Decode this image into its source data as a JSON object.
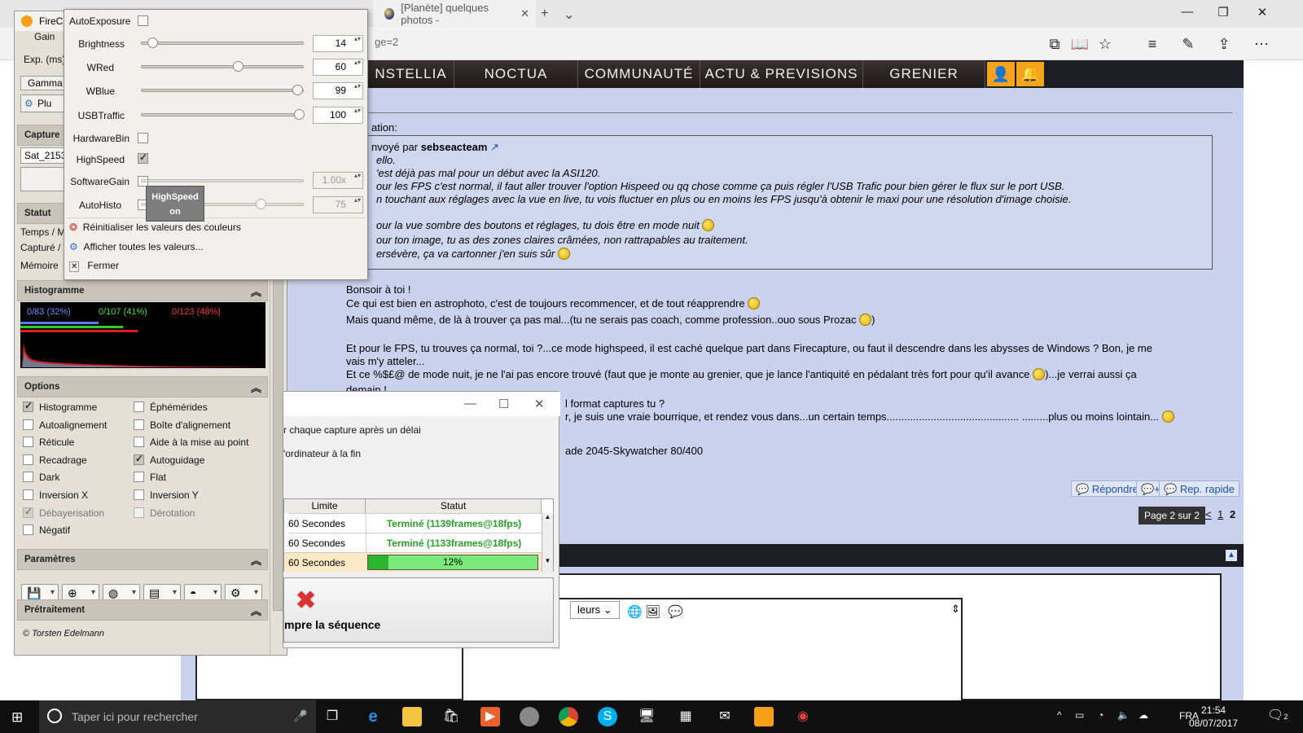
{
  "browser": {
    "tab_title": "[Planète] quelques photos -",
    "url_fragment": "ge=2",
    "nav_items": [
      "NSTELLIA",
      "NOCTUA",
      "COMMUNAUTÉ",
      "ACTU & PREVISIONS",
      "GRENIER"
    ]
  },
  "post": {
    "quote_header_label": "ation:",
    "quote_sender_prefix": "nvoyé par ",
    "quote_sender": "sebseacteam",
    "quote_lines": [
      "ello.",
      "'est déjà pas mal pour un début avec la ASI120.",
      "our les FPS c'est normal, il faut aller trouver l'option Hispeed ou qq chose comme ça puis régler l'USB Trafic pour bien gérer le flux sur le port USB.",
      "n touchant aux réglages avec la vue en live, tu vois fluctuer en plus ou en moins les FPS jusqu'à obtenir le maxi pour une résolution d'image choisie.",
      "our la vue sombre des boutons et réglages, tu dois être en mode nuit",
      "our ton image, tu as des zones claires crâmées, non rattrapables au traitement.",
      "ersévère, ça va cartonner j'en suis sûr"
    ],
    "body_lines": [
      "Bonsoir à toi !",
      "Ce qui est bien en astrophoto, c'est de toujours recommencer, et de tout réapprendre",
      "Mais quand même, de là à trouver ça pas mal...(tu ne serais pas coach, comme profession..ouo sous Prozac",
      "Et pour le FPS, tu trouves ça normal, toi ?...ce mode highspeed, il est caché quelque part dans Firecapture, ou faut il descendre dans les abysses de Windows ? Bon, je me",
      "vais m'y atteler...",
      "Et ce %$£@ de mode nuit, je ne l'ai pas encore trouvé (faut que je monte au grenier, que je lance l'antiquité en pédalant très fort pour qu'il avance",
      "demain !",
      "l format captures tu ?",
      "r, je suis une vraie bourrique, et rendez vous dans...un certain temps............................................. .........plus ou moins lointain...",
      "ade 2045-Skywatcher 80/400"
    ],
    "body_line6_suffix": ")...je verrai aussi ça",
    "body_line2_suffix": ")",
    "actions": [
      "Répondre",
      "Rep. rapide"
    ],
    "pager_label": "Page 2 sur 2",
    "pager_links": [
      "<",
      "1",
      "2"
    ],
    "editor_colors_label": "leurs"
  },
  "firecapture": {
    "title": "FireCa",
    "gain_label": "Gain",
    "exp_label": "Exp. (ms)",
    "gamma_label": "Gamma",
    "plus_label": "Plu",
    "capture_section": "Capture",
    "capture_name": "Sat_2153",
    "statut_section": "Statut",
    "statut_lines": [
      "Temps / M",
      "Capturé /",
      "Mémoire"
    ],
    "histogram_section": "Histogramme",
    "histogram_stats": [
      "0/83 (32%)",
      "0/107 (41%)",
      "0/123 (48%)"
    ],
    "options_section": "Options",
    "options_left": [
      {
        "label": "Histogramme",
        "checked": true
      },
      {
        "label": "Autoalignement",
        "checked": false
      },
      {
        "label": "Réticule",
        "checked": false
      },
      {
        "label": "Recadrage",
        "checked": false
      },
      {
        "label": "Dark",
        "checked": false
      },
      {
        "label": "Inversion X",
        "checked": false
      },
      {
        "label": "Débayerisation",
        "checked": true
      },
      {
        "label": "Négatif",
        "checked": false
      }
    ],
    "options_right": [
      {
        "label": "Éphémérides",
        "checked": false
      },
      {
        "label": "Boîte d'alignement",
        "checked": false
      },
      {
        "label": "Aide à la mise au point",
        "checked": false
      },
      {
        "label": "Autoguidage",
        "checked": true
      },
      {
        "label": "Flat",
        "checked": false
      },
      {
        "label": "Inversion Y",
        "checked": false
      },
      {
        "label": "Dérotation",
        "checked": false
      }
    ],
    "parametres_section": "Paramètres",
    "pretraitement_section": "Prétraitement",
    "footer": "© Torsten Edelmann"
  },
  "autoexposure": {
    "title_checkbox_label": "AutoExposure",
    "sliders": [
      {
        "label": "Brightness",
        "value": "14",
        "fraction": 0.04
      },
      {
        "label": "WRed",
        "value": "60",
        "fraction": 0.6
      },
      {
        "label": "WBlue",
        "value": "99",
        "fraction": 0.99
      },
      {
        "label": "USBTraffic",
        "value": "100",
        "fraction": 1.0
      }
    ],
    "hardware_bin_label": "HardwareBin",
    "highspeed_label": "HighSpeed",
    "softwaregain_label": "SoftwareGain",
    "softwaregain_value": "1.00x",
    "autohisto_label": "AutoHisto",
    "autohisto_value": "75",
    "autohisto_fraction": 0.75,
    "tooltip_title": "HighSpeed",
    "tooltip_value": "on",
    "menu": [
      "Réinitialiser les valeurs des couleurs",
      "Afficher toutes les valeurs...",
      "Fermer"
    ]
  },
  "sequence": {
    "option1": "r chaque capture après un délai",
    "option2": "'ordinateur à la fin",
    "col_limit": "Limite",
    "col_status": "Statut",
    "rows": [
      {
        "limit": "60 Secondes",
        "status": "Terminé  (1139frames@18fps)"
      },
      {
        "limit": "60 Secondes",
        "status": "Terminé  (1133frames@18fps)"
      },
      {
        "limit": "60 Secondes",
        "status": "12%"
      }
    ],
    "progress": 0.12,
    "stop_label": "mpre la séquence"
  },
  "taskbar": {
    "search_placeholder": "Taper ici pour rechercher",
    "lang": "FRA",
    "time": "21:54",
    "date": "08/07/2017",
    "notif_count": "2"
  }
}
